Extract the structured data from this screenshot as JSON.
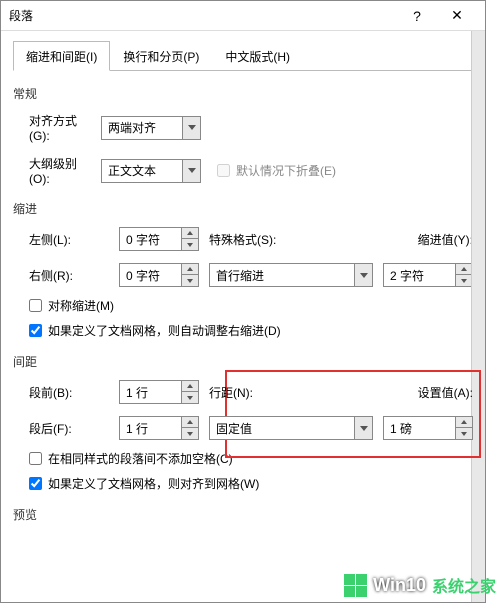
{
  "titlebar": {
    "title": "段落"
  },
  "tabs": {
    "indent_spacing": "缩进和间距(I)",
    "line_page": "换行和分页(P)",
    "asian": "中文版式(H)"
  },
  "sections": {
    "general": "常规",
    "indent": "缩进",
    "spacing": "间距",
    "preview": "预览"
  },
  "general": {
    "alignment_label": "对齐方式(G):",
    "alignment_value": "两端对齐",
    "outline_label": "大纲级别(O):",
    "outline_value": "正文文本",
    "collapse_label": "默认情况下折叠(E)"
  },
  "indent": {
    "left_label": "左侧(L):",
    "left_value": "0 字符",
    "right_label": "右侧(R):",
    "right_value": "0 字符",
    "special_label": "特殊格式(S):",
    "special_value": "首行缩进",
    "by_label": "缩进值(Y):",
    "by_value": "2 字符",
    "mirror_label": "对称缩进(M)",
    "autoadjust_label": "如果定义了文档网格，则自动调整右缩进(D)"
  },
  "spacing": {
    "before_label": "段前(B):",
    "before_value": "1 行",
    "after_label": "段后(F):",
    "after_value": "1 行",
    "linespacing_label": "行距(N):",
    "linespacing_value": "固定值",
    "at_label": "设置值(A):",
    "at_value": "1 磅",
    "noaddspace_label": "在相同样式的段落间不添加空格(C)",
    "snapgrid_label": "如果定义了文档网格，则对齐到网格(W)"
  },
  "watermark": {
    "brand": "Win10",
    "site": "系统之家"
  }
}
